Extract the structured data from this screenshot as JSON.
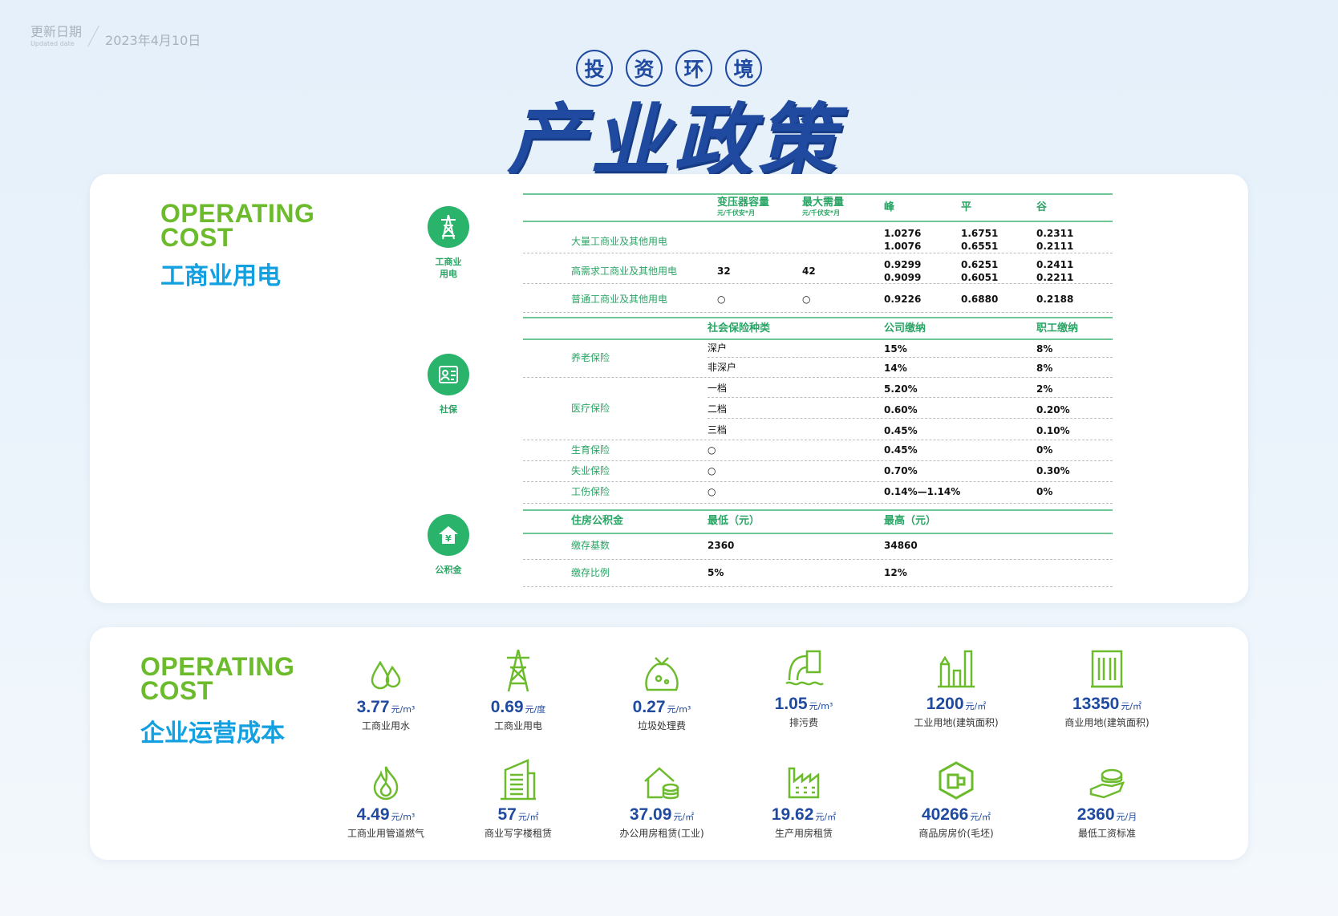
{
  "header": {
    "updated_label": "更新日期",
    "updated_label_en": "Updated date",
    "updated_date": "2023年4月10日",
    "subtitle_chars": [
      "投",
      "资",
      "环",
      "境"
    ],
    "title": "产业政策"
  },
  "card1": {
    "operating": "OPERATING",
    "cost": "COST",
    "title_cn": "工商业用电",
    "sections": {
      "electric_icon_label": "工商业用电",
      "social_icon_label": "社保",
      "fund_icon_label": "公积金"
    },
    "electric": {
      "headers": {
        "transformer": "变压器容量",
        "transformer_unit": "元/千伏安*月",
        "max_demand": "最大需量",
        "max_demand_unit": "元/千伏安*月",
        "peak": "峰",
        "flat": "平",
        "valley": "谷"
      },
      "rows": [
        {
          "name": "大量工商业及其他用电",
          "transformer": "",
          "demand": "",
          "peak": "1.0276\n1.0076",
          "flat": "1.6751\n0.6551",
          "valley": "0.2311\n0.2111"
        },
        {
          "name": "高需求工商业及其他用电",
          "transformer": "32",
          "demand": "42",
          "peak": "0.9299\n0.9099",
          "flat": "0.6251\n0.6051",
          "valley": "0.2411\n0.2211"
        },
        {
          "name": "普通工商业及其他用电",
          "transformer": "○",
          "demand": "○",
          "peak": "0.9226",
          "flat": "0.6880",
          "valley": "0.2188"
        }
      ]
    },
    "social": {
      "headers": {
        "type": "社会保险种类",
        "company": "公司缴纳",
        "employee": "职工缴纳"
      },
      "pension": "养老保险",
      "pension_rows": [
        {
          "type": "深户",
          "company": "15%",
          "employee": "8%"
        },
        {
          "type": "非深户",
          "company": "14%",
          "employee": "8%"
        }
      ],
      "medical": "医疗保险",
      "medical_rows": [
        {
          "type": "一档",
          "company": "5.20%",
          "employee": "2%"
        },
        {
          "type": "二档",
          "company": "0.60%",
          "employee": "0.20%"
        },
        {
          "type": "三档",
          "company": "0.45%",
          "employee": "0.10%"
        }
      ],
      "other_rows": [
        {
          "name": "生育保险",
          "type": "○",
          "company": "0.45%",
          "employee": "0%"
        },
        {
          "name": "失业保险",
          "type": "○",
          "company": "0.70%",
          "employee": "0.30%"
        },
        {
          "name": "工伤保险",
          "type": "○",
          "company": "0.14%—1.14%",
          "employee": "0%"
        }
      ]
    },
    "fund": {
      "headers": {
        "name": "住房公积金",
        "min": "最低（元）",
        "max": "最高（元）"
      },
      "rows": [
        {
          "name": "缴存基数",
          "min": "2360",
          "max": "34860"
        },
        {
          "name": "缴存比例",
          "min": "5%",
          "max": "12%"
        }
      ]
    }
  },
  "card2": {
    "operating": "OPERATING",
    "cost": "COST",
    "title_cn": "企业运营成本",
    "tiles": [
      {
        "icon": "water-drops-icon",
        "value": "3.77",
        "unit": "元/m³",
        "caption": "工商业用水"
      },
      {
        "icon": "power-tower-icon",
        "value": "0.69",
        "unit": "元/度",
        "caption": "工商业用电"
      },
      {
        "icon": "garbage-bag-icon",
        "value": "0.27",
        "unit": "元/m³",
        "caption": "垃圾处理费"
      },
      {
        "icon": "sewage-pipe-icon",
        "value": "1.05",
        "unit": "元/m³",
        "caption": "排污费"
      },
      {
        "icon": "factory-icon",
        "value": "1200",
        "unit": "元/㎡",
        "caption": "工业用地(建筑面积)"
      },
      {
        "icon": "building-icon",
        "value": "13350",
        "unit": "元/㎡",
        "caption": "商业用地(建筑面积)"
      },
      {
        "icon": "flame-icon",
        "value": "4.49",
        "unit": "元/m³",
        "caption": "工商业用管道燃气"
      },
      {
        "icon": "office-tower-icon",
        "value": "57",
        "unit": "元/㎡",
        "caption": "商业写字楼租赁"
      },
      {
        "icon": "house-coins-icon",
        "value": "37.09",
        "unit": "元/㎡",
        "caption": "办公用房租赁(工业)"
      },
      {
        "icon": "workshop-icon",
        "value": "19.62",
        "unit": "元/㎡",
        "caption": "生产用房租赁"
      },
      {
        "icon": "house-box-icon",
        "value": "40266",
        "unit": "元/㎡",
        "caption": "商品房房价(毛坯)"
      },
      {
        "icon": "salary-hand-icon",
        "value": "2360",
        "unit": "元/月",
        "caption": "最低工资标准"
      }
    ]
  },
  "colors": {
    "green": "#6cbb2c",
    "blue_cn": "#13a0e0",
    "navy": "#1f4aa0",
    "table_green": "#2aa565"
  }
}
